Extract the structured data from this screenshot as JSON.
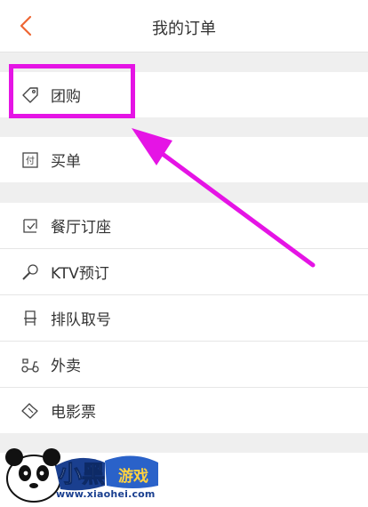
{
  "navbar": {
    "title": "我的订单",
    "back_icon": "chevron-left-icon",
    "accent": "#ee6633"
  },
  "sections": [
    {
      "items": [
        {
          "label": "团购",
          "icon": "tag-icon"
        }
      ]
    },
    {
      "items": [
        {
          "label": "买单",
          "icon": "pay-icon",
          "icon_text": "付"
        }
      ]
    },
    {
      "items": [
        {
          "label": "餐厅订座",
          "icon": "calendar-check-icon"
        },
        {
          "label": "KTV预订",
          "icon": "microphone-icon"
        },
        {
          "label": "排队取号",
          "icon": "chair-icon"
        },
        {
          "label": "外卖",
          "icon": "scooter-icon"
        },
        {
          "label": "电影票",
          "icon": "ticket-icon"
        }
      ]
    }
  ],
  "annotation": {
    "color": "#e514e5"
  },
  "watermark": {
    "brand": "小黑游戏",
    "site": "www.xiaohei.com"
  }
}
